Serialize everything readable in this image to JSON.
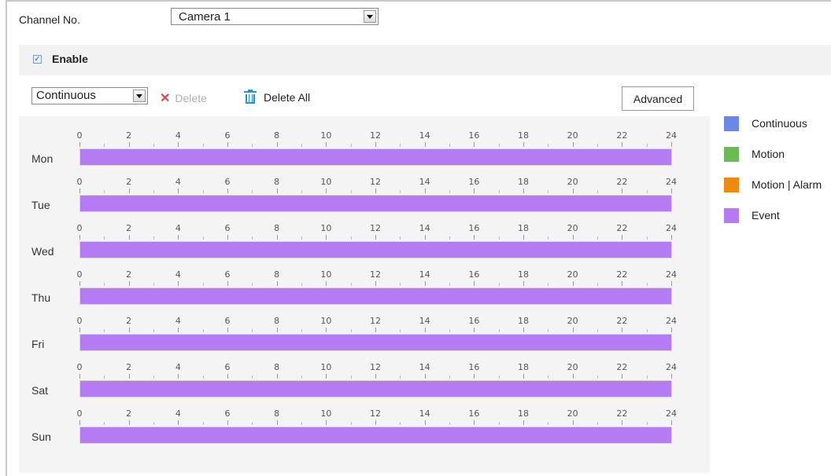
{
  "channel": {
    "label": "Channel No.",
    "value": "Camera 1"
  },
  "enable": {
    "checked": true,
    "label": "Enable"
  },
  "toolbar": {
    "type_value": "Continuous",
    "delete_label": "Delete",
    "delete_all_label": "Delete All",
    "advanced_label": "Advanced"
  },
  "ticks": [
    "0",
    "2",
    "4",
    "6",
    "8",
    "10",
    "12",
    "14",
    "16",
    "18",
    "20",
    "22",
    "24"
  ],
  "legend": [
    {
      "label": "Continuous",
      "color": "#6b87e8"
    },
    {
      "label": "Motion",
      "color": "#6cba55"
    },
    {
      "label": "Motion | Alarm",
      "color": "#ec8a12"
    },
    {
      "label": "Event",
      "color": "#b57bf2"
    }
  ],
  "schedule": [
    {
      "day": "Mon",
      "segments": [
        {
          "start": 0,
          "end": 24,
          "type": "Event"
        }
      ]
    },
    {
      "day": "Tue",
      "segments": [
        {
          "start": 0,
          "end": 24,
          "type": "Event"
        }
      ]
    },
    {
      "day": "Wed",
      "segments": [
        {
          "start": 0,
          "end": 24,
          "type": "Event"
        }
      ]
    },
    {
      "day": "Thu",
      "segments": [
        {
          "start": 0,
          "end": 24,
          "type": "Event"
        }
      ]
    },
    {
      "day": "Fri",
      "segments": [
        {
          "start": 0,
          "end": 24,
          "type": "Event"
        }
      ]
    },
    {
      "day": "Sat",
      "segments": [
        {
          "start": 0,
          "end": 24,
          "type": "Event"
        }
      ]
    },
    {
      "day": "Sun",
      "segments": [
        {
          "start": 0,
          "end": 24,
          "type": "Event"
        }
      ]
    }
  ]
}
